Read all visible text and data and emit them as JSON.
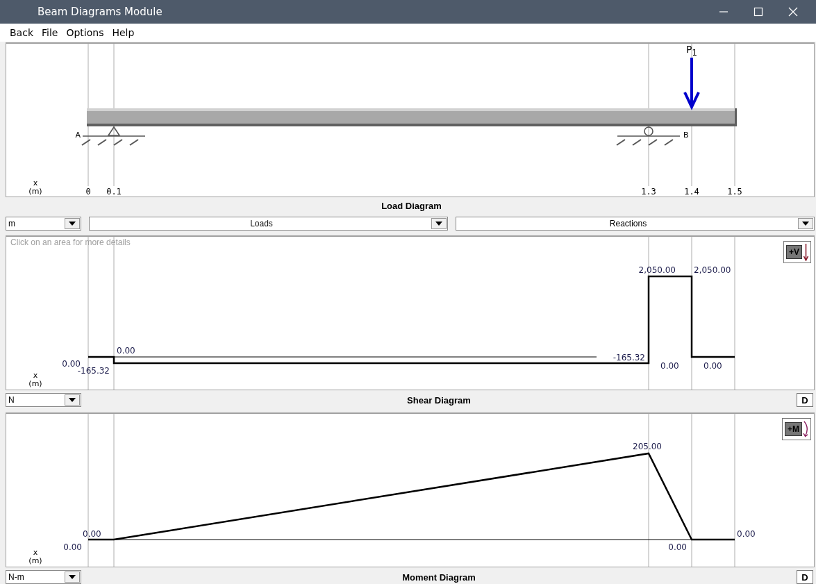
{
  "window": {
    "title": "Beam Diagrams Module"
  },
  "menu": [
    "Back",
    "File",
    "Options",
    "Help"
  ],
  "load_diagram": {
    "title": "Load Diagram",
    "axis_label": "x",
    "axis_unit": "(m)",
    "xticks": [
      "0",
      "0.1",
      "1.3",
      "1.4",
      "1.5"
    ],
    "supports": [
      {
        "label": "A",
        "kind": "pin"
      },
      {
        "label": "B",
        "kind": "roller"
      }
    ],
    "loads": [
      {
        "label": "P$_{1}$"
      }
    ],
    "unit": "m",
    "loads_combo": "Loads",
    "reactions_combo": "Reactions"
  },
  "shear_diagram": {
    "title": "Shear Diagram",
    "unit": "N",
    "hint": "Click on an area for more details",
    "sign_button": "+V",
    "detail_button": "D",
    "axis_label": "x",
    "axis_unit": "(m)",
    "value_labels": [
      "0.00",
      "-165.32",
      "0.00",
      "-165.32",
      "2,050.00",
      "2,050.00",
      "0.00",
      "0.00"
    ]
  },
  "moment_diagram": {
    "title": "Moment Diagram",
    "unit": "N-m",
    "sign_button": "+M",
    "detail_button": "D",
    "axis_label": "x",
    "axis_unit": "(m)",
    "value_labels": [
      "0.00",
      "0.00",
      "205.00",
      "0.00",
      "0.00"
    ]
  }
}
